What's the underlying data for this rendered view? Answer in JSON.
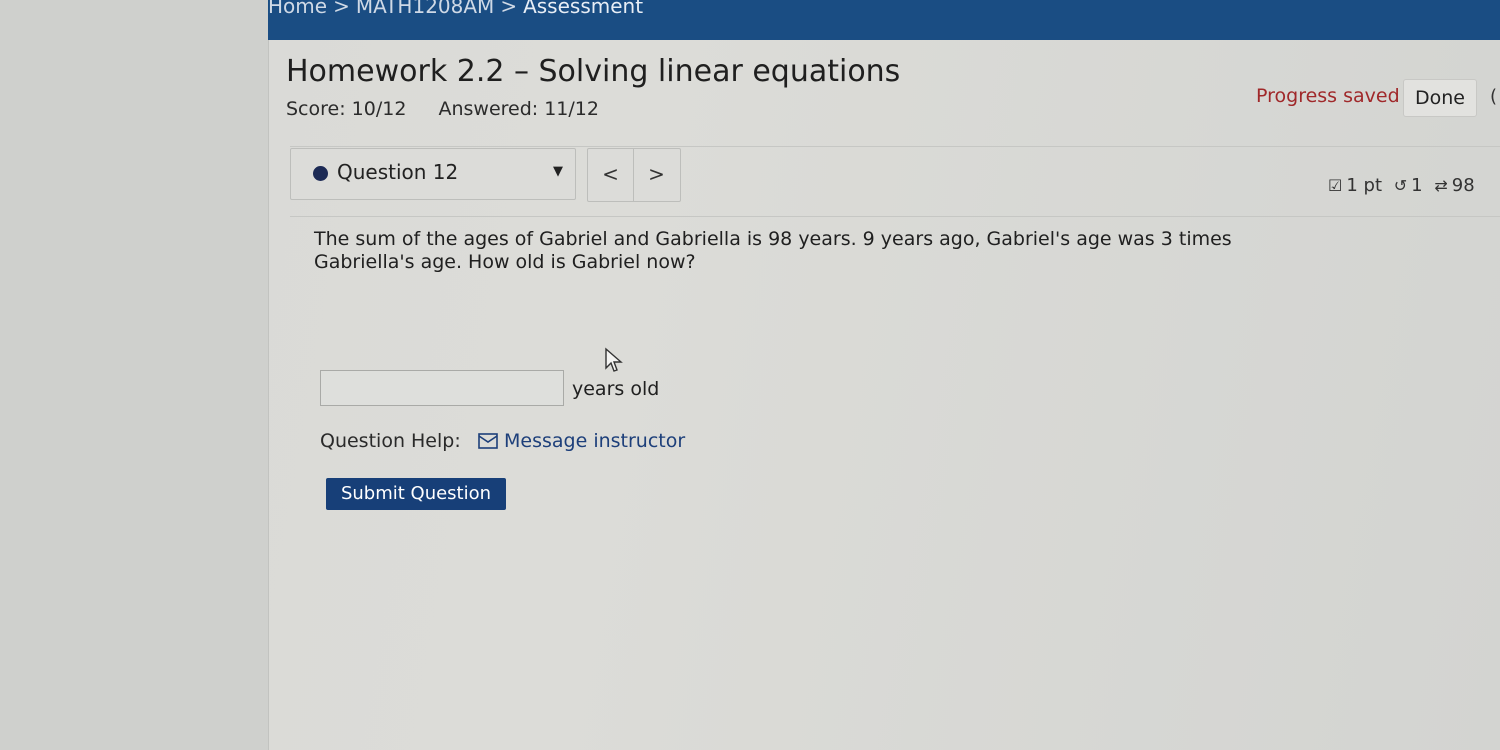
{
  "breadcrumb": [
    "Home",
    "MATH1208AM",
    "Assessment"
  ],
  "breadcrumb_separator": ">",
  "homework": {
    "title": "Homework 2.2 – Solving linear equations",
    "score": "Score: 10/12",
    "answered": "Answered: 11/12",
    "progress": "Progress saved",
    "done_label": "Done"
  },
  "question_nav": {
    "selected": "Question 12",
    "prev": "<",
    "next": ">",
    "points": "1 pt",
    "attempts": "1",
    "versions": "98"
  },
  "question": {
    "text": "The sum of the ages of Gabriel and Gabriella is 98 years. 9 years ago, Gabriel's age was 3 times Gabriella's age. How old is Gabriel now?",
    "answer_value": "",
    "unit": "years old"
  },
  "help": {
    "label": "Question Help:",
    "link": "Message instructor"
  },
  "submit_label": "Submit Question",
  "colors": {
    "header_blue": "#1a4d83",
    "submit_blue": "#173f78",
    "progress_red": "#a0282a"
  }
}
